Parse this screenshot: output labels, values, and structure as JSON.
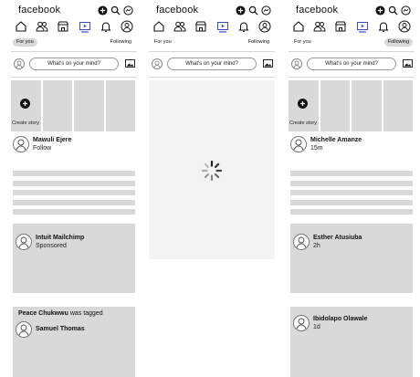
{
  "brand": "facebook",
  "tabs": {
    "for_you": "For you",
    "following": "Following"
  },
  "composer_placeholder": "What's on your mind?",
  "screen1": {
    "create_story": "Create story",
    "suggestion": {
      "name": "Mawuli Ejere",
      "action": "Follow"
    },
    "ad": {
      "name": "Intuit Mailchimp",
      "label": "Sponsored"
    },
    "tag_post": {
      "actor": "Peace Chukwwu",
      "verb": "was tagged",
      "tagged": "Samuel Thomas"
    }
  },
  "screen3": {
    "create_story": "Create story",
    "post1": {
      "name": "Michelle Amanze",
      "time": "15m"
    },
    "post2": {
      "name": "Esther Atusiuba",
      "time": "2h"
    },
    "post3": {
      "name": "Ibidolapo Olawale",
      "time": "1d"
    }
  },
  "icons": {
    "top": [
      "plus-circle-icon",
      "search-icon",
      "messenger-icon"
    ],
    "nav": [
      "home-icon",
      "friends-icon",
      "marketplace-icon",
      "video-icon",
      "notifications-icon",
      "profile-icon"
    ],
    "loading": "loading-spinner-icon"
  }
}
